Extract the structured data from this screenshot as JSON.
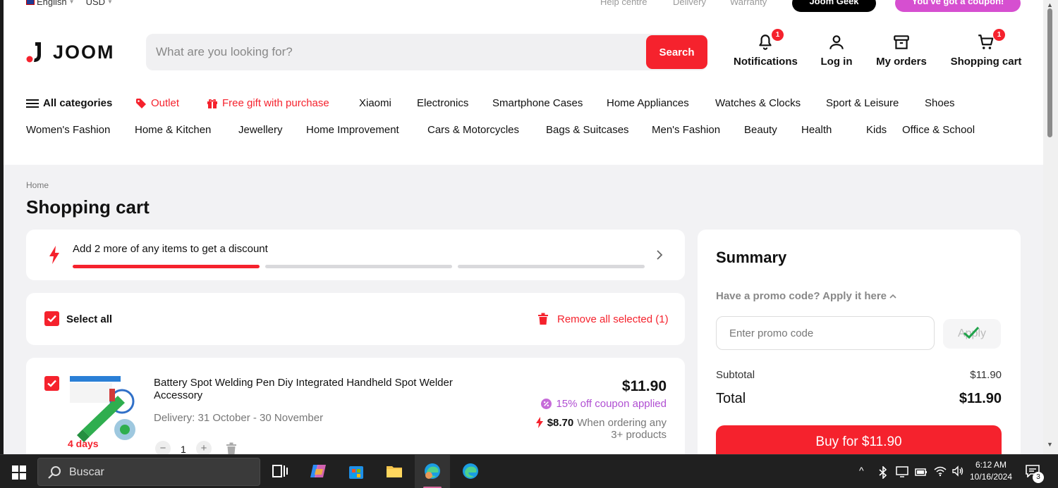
{
  "topbar": {
    "language": "English",
    "currency": "USD",
    "links": [
      "Help centre",
      "Delivery",
      "Warranty"
    ],
    "geek_label": "Joom Geek",
    "coupon_label": "You've got a coupon!"
  },
  "brand": {
    "logo_text": "JOOM",
    "accent_color": "#f5222d"
  },
  "search": {
    "placeholder": "What are you looking for?",
    "button_label": "Search"
  },
  "header_actions": {
    "notifications": {
      "label": "Notifications",
      "badge": "1"
    },
    "login": {
      "label": "Log in"
    },
    "orders": {
      "label": "My orders"
    },
    "cart": {
      "label": "Shopping cart",
      "badge": "1"
    }
  },
  "categories": {
    "row1": [
      "All categories",
      "Outlet",
      "Free gift with purchase",
      "Xiaomi",
      "Electronics",
      "Smartphone Cases",
      "Home Appliances",
      "Watches & Clocks",
      "Sport & Leisure",
      "Shoes"
    ],
    "row2": [
      "Women's Fashion",
      "Home & Kitchen",
      "Jewellery",
      "Home Improvement",
      "Cars & Motorcycles",
      "Bags & Suitcases",
      "Men's Fashion",
      "Beauty",
      "Health",
      "Kids",
      "Office & School"
    ]
  },
  "breadcrumb": "Home",
  "page_title": "Shopping cart",
  "discount_banner": {
    "text": "Add 2 more of any items to get a discount",
    "progress_steps_filled": 1,
    "progress_steps_total": 3
  },
  "selection": {
    "select_all_label": "Select all",
    "remove_label": "Remove all selected (1)"
  },
  "cart_item": {
    "title": "Battery Spot Welding Pen Diy Integrated Handheld Spot Welder Accessory",
    "delivery": "Delivery: 31 October - 30 November",
    "delivery_days": "4 days",
    "price": "$11.90",
    "coupon": "15% off coupon applied",
    "bulk_price": "$8.70",
    "bulk_text": "When ordering any",
    "bulk_text2": "3+ products",
    "quantity": "1",
    "minus": "−",
    "plus": "+"
  },
  "summary": {
    "title": "Summary",
    "promo_prompt": "Have a promo code? Apply it here",
    "promo_placeholder": "Enter promo code",
    "apply_label": "Apply",
    "subtotal_label": "Subtotal",
    "subtotal_value": "$11.90",
    "total_label": "Total",
    "total_value": "$11.90",
    "buy_label": "Buy for $11.90"
  },
  "taskbar": {
    "search_placeholder": "Buscar",
    "time": "6:12 AM",
    "date": "10/16/2024",
    "notification_count": "3"
  }
}
